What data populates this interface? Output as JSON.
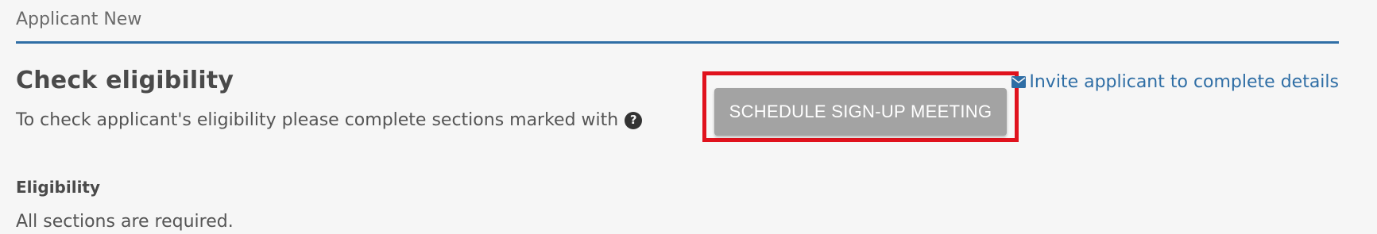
{
  "header": {
    "applicant_name": "Applicant New"
  },
  "eligibility_check": {
    "title": "Check eligibility",
    "instructions": "To check applicant's eligibility please complete sections marked with",
    "help_icon": "question-circle-icon"
  },
  "actions": {
    "schedule_button_label": "SCHEDULE SIGN-UP MEETING",
    "invite_link_label": "Invite applicant to complete details",
    "invite_icon": "envelope-icon"
  },
  "eligibility_section": {
    "heading": "Eligibility",
    "note": "All sections are required."
  },
  "colors": {
    "accent": "#2f6ea5",
    "button_disabled": "#a3a3a3",
    "highlight": "#e0121d",
    "background": "#f6f6f6"
  }
}
